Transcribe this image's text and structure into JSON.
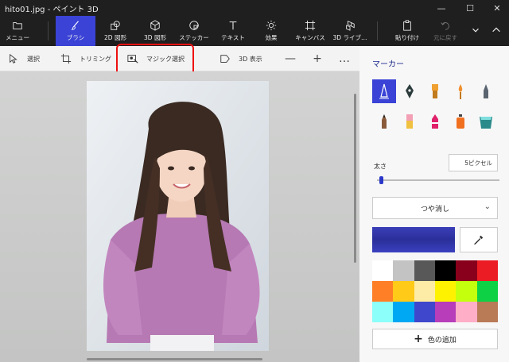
{
  "window": {
    "title": "hito01.jpg - ペイント 3D",
    "controls": {
      "minimize": "—",
      "maximize": "☐",
      "close": "✕"
    }
  },
  "toolbar": {
    "items": [
      {
        "label": "メニュー",
        "icon": "folder-icon"
      },
      {
        "label": "ブラシ",
        "icon": "brush-icon",
        "active": true
      },
      {
        "label": "2D 図形",
        "icon": "2d-shapes-icon"
      },
      {
        "label": "3D 図形",
        "icon": "3d-shapes-icon"
      },
      {
        "label": "ステッカー",
        "icon": "sticker-icon"
      },
      {
        "label": "テキスト",
        "icon": "text-icon"
      },
      {
        "label": "効果",
        "icon": "effects-icon"
      },
      {
        "label": "キャンバス",
        "icon": "canvas-icon"
      },
      {
        "label": "3D ライブ…",
        "icon": "3d-library-icon"
      },
      {
        "label": "貼り付け",
        "icon": "paste-icon"
      },
      {
        "label": "元に戻す",
        "icon": "undo-icon",
        "disabled": true
      }
    ]
  },
  "subbar": {
    "select": "選択",
    "crop": "トリミング",
    "magic_select": "マジック選択",
    "view_3d": "3D 表示",
    "zoom_out": "—",
    "zoom_in": "+",
    "more": "…"
  },
  "panel": {
    "title": "マーカー",
    "brushes": [
      "marker-icon",
      "calligraphy-pen-icon",
      "oil-brush-icon",
      "watercolor-icon",
      "pixel-pen-icon",
      "pencil-icon",
      "eraser-icon",
      "crayon-icon",
      "spray-can-icon",
      "fill-bucket-icon"
    ],
    "thickness_label": "太さ",
    "thickness_value": "5ピクセル",
    "thickness": 0.02,
    "finish": "つや消し",
    "selected_color": "#2e33a8",
    "palette": [
      "#ffffff",
      "#c3c3c3",
      "#585858",
      "#000000",
      "#88001b",
      "#ec1c24",
      "#ff7f27",
      "#ffca18",
      "#fdeca6",
      "#fff200",
      "#c4ff0e",
      "#0ed145",
      "#8cfffb",
      "#00a8f3",
      "#3f48cc",
      "#b83dba",
      "#ffaec8",
      "#b97a56"
    ],
    "add_color": "色の追加"
  }
}
